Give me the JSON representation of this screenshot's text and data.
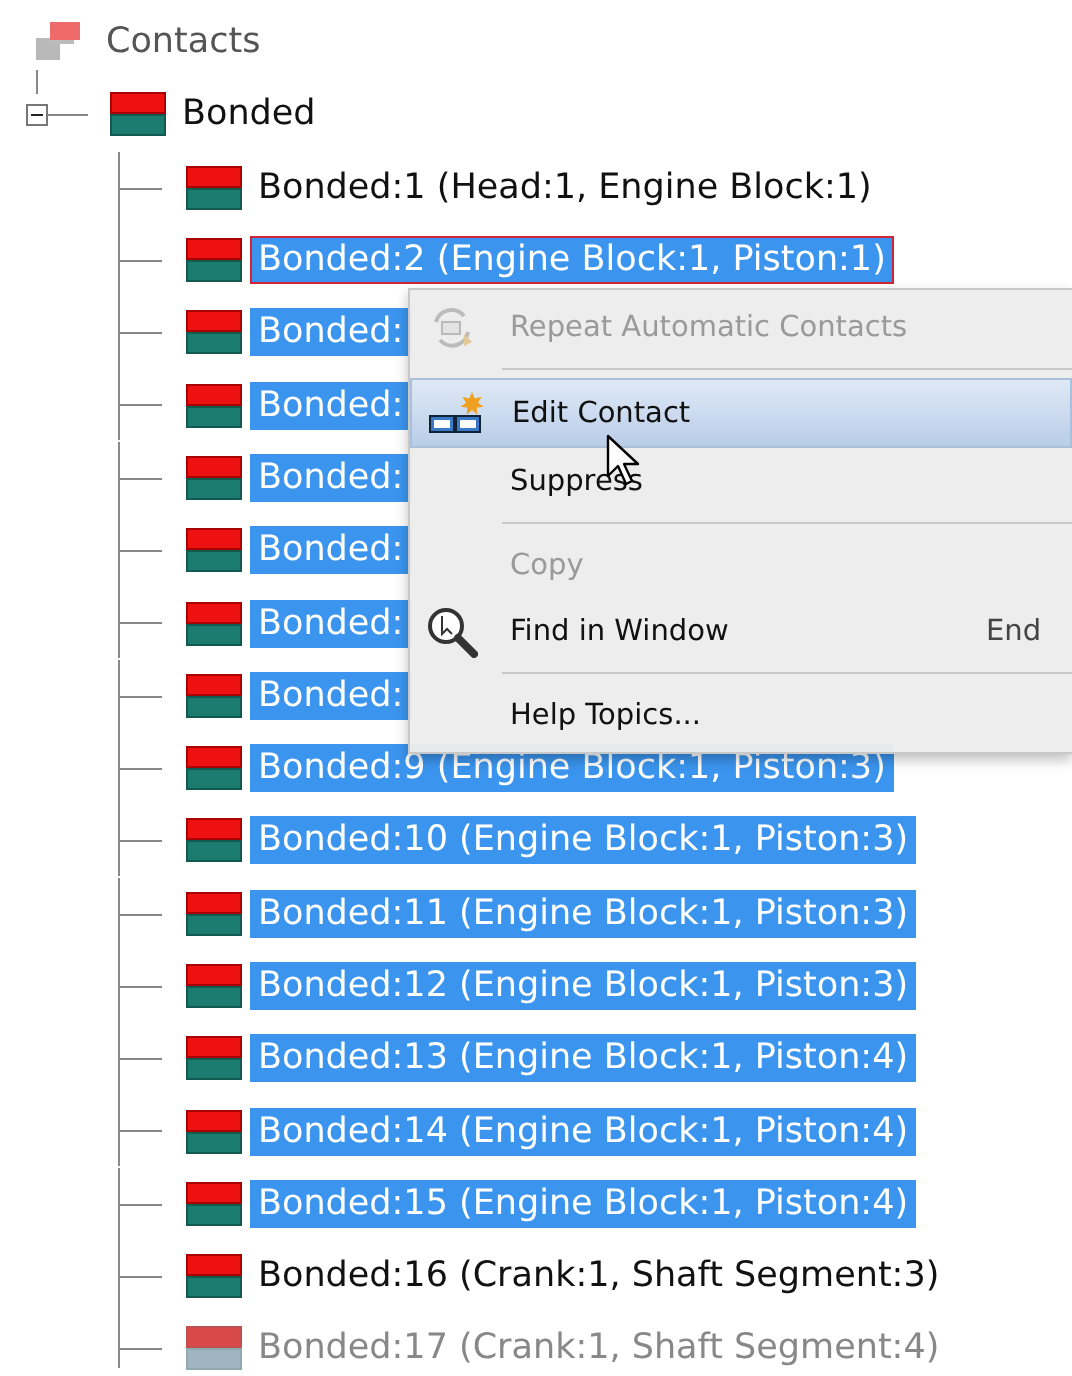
{
  "tree": {
    "label": "Contacts",
    "children": [
      {
        "label": "Bonded",
        "expanded": true,
        "children": [
          {
            "label": "Bonded:1 (Head:1, Engine Block:1)",
            "selected": false,
            "focused": false,
            "suppressed": false
          },
          {
            "label": "Bonded:2 (Engine Block:1, Piston:1)",
            "selected": true,
            "focused": true,
            "suppressed": false
          },
          {
            "label": "Bonded:",
            "selected": true,
            "focused": false,
            "suppressed": false
          },
          {
            "label": "Bonded:",
            "selected": true,
            "focused": false,
            "suppressed": false
          },
          {
            "label": "Bonded:",
            "selected": true,
            "focused": false,
            "suppressed": false
          },
          {
            "label": "Bonded:",
            "selected": true,
            "focused": false,
            "suppressed": false
          },
          {
            "label": "Bonded:",
            "selected": true,
            "focused": false,
            "suppressed": false
          },
          {
            "label": "Bonded:",
            "selected": true,
            "focused": false,
            "suppressed": false
          },
          {
            "label": "Bonded:9 (Engine Block:1, Piston:3)",
            "selected": true,
            "focused": false,
            "suppressed": false
          },
          {
            "label": "Bonded:10 (Engine Block:1, Piston:3)",
            "selected": true,
            "focused": false,
            "suppressed": false
          },
          {
            "label": "Bonded:11 (Engine Block:1, Piston:3)",
            "selected": true,
            "focused": false,
            "suppressed": false
          },
          {
            "label": "Bonded:12 (Engine Block:1, Piston:3)",
            "selected": true,
            "focused": false,
            "suppressed": false
          },
          {
            "label": "Bonded:13 (Engine Block:1, Piston:4)",
            "selected": true,
            "focused": false,
            "suppressed": false
          },
          {
            "label": "Bonded:14 (Engine Block:1, Piston:4)",
            "selected": true,
            "focused": false,
            "suppressed": false
          },
          {
            "label": "Bonded:15 (Engine Block:1, Piston:4)",
            "selected": true,
            "focused": false,
            "suppressed": false
          },
          {
            "label": "Bonded:16 (Crank:1, Shaft Segment:3)",
            "selected": false,
            "focused": false,
            "suppressed": false
          },
          {
            "label": "Bonded:17 (Crank:1, Shaft Segment:4)",
            "selected": false,
            "focused": false,
            "suppressed": true
          }
        ]
      }
    ]
  },
  "context_menu": {
    "items": [
      {
        "kind": "item",
        "label": "Repeat Automatic Contacts",
        "disabled": true,
        "selected": false
      },
      {
        "kind": "separator"
      },
      {
        "kind": "item",
        "label": "Edit Contact",
        "disabled": false,
        "selected": true
      },
      {
        "kind": "item",
        "label": "Suppress",
        "disabled": false,
        "selected": false
      },
      {
        "kind": "separator"
      },
      {
        "kind": "item",
        "label": "Copy",
        "disabled": true,
        "selected": false
      },
      {
        "kind": "item",
        "label": "Find in Window",
        "disabled": false,
        "selected": false,
        "shortcut": "End"
      },
      {
        "kind": "separator"
      },
      {
        "kind": "item",
        "label": "Help Topics...",
        "disabled": false,
        "selected": false
      }
    ]
  }
}
